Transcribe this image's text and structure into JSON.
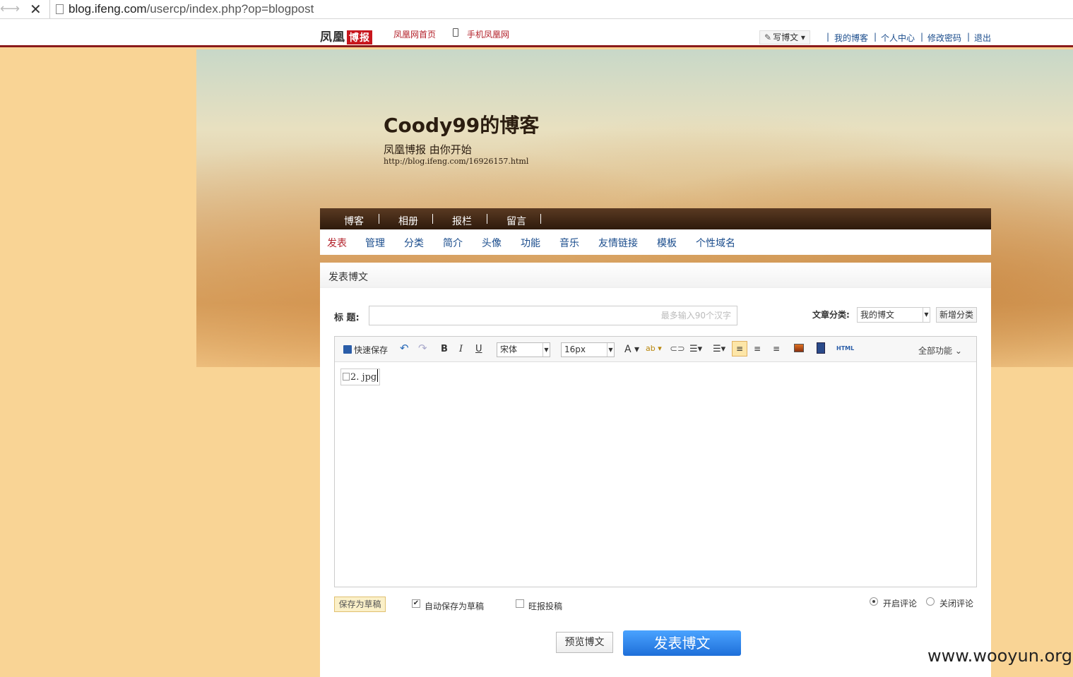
{
  "browser": {
    "url_host": "blog.ifeng.com",
    "url_path": "/usercp/index.php?op=blogpost"
  },
  "topnav": {
    "logo_text": "凤凰",
    "logo_badge": "博报",
    "home_link": "凤凰网首页",
    "mobile_link": "手机凤凰网",
    "write_button": "写博文",
    "user_links": [
      "我的博客",
      "个人中心",
      "修改密码",
      "退出"
    ]
  },
  "banner": {
    "title": "Coody99的博客",
    "subtitle": "凤凰博报  由你开始",
    "url": "http://blog.ifeng.com/16926157.html"
  },
  "main_nav": [
    "博客",
    "相册",
    "报栏",
    "留言"
  ],
  "sub_nav": [
    "发表",
    "管理",
    "分类",
    "简介",
    "头像",
    "功能",
    "音乐",
    "友情链接",
    "模板",
    "个性域名"
  ],
  "panel": {
    "title": "发表博文",
    "title_label": "标 题:",
    "title_placeholder": "最多输入90个汉字",
    "category_label": "文章分类:",
    "category_value": "我的博文",
    "new_category_button": "新增分类"
  },
  "toolbar": {
    "quick_save": "快速保存",
    "bold": "B",
    "italic": "I",
    "underline": "U",
    "font_family": "宋体",
    "font_size": "16px",
    "font_color": "A",
    "bg_color": "ab",
    "html_label": "HTML",
    "all_functions": "全部功能"
  },
  "editor": {
    "content_image_alt": "2. jpg"
  },
  "bottom": {
    "save_draft": "保存为草稿",
    "auto_save_label": "自动保存为草稿",
    "auto_save_checked": true,
    "wangbao_label": "旺报投稿",
    "wangbao_checked": false,
    "enable_comments": "开启评论",
    "disable_comments": "关闭评论",
    "preview_button": "预览博文",
    "publish_button": "发表博文"
  },
  "watermark": "www.wooyun.org"
}
